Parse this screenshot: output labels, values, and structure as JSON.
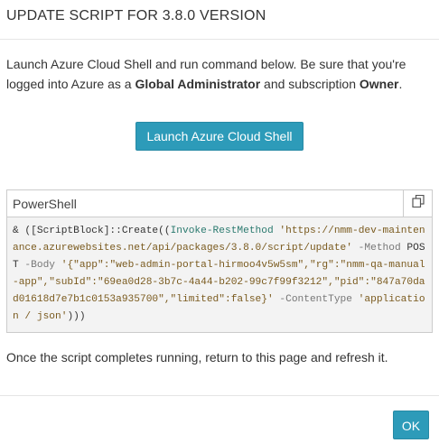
{
  "dialog": {
    "title": "UPDATE SCRIPT FOR 3.8.0 VERSION",
    "intro_text_1": "Launch Azure Cloud Shell and run command below. Be sure that you're logged into Azure as a ",
    "intro_bold_1": "Global Administrator",
    "intro_text_2": " and subscription ",
    "intro_bold_2": "Owner",
    "intro_text_3": ".",
    "launch_button": "Launch Azure Cloud Shell",
    "code": {
      "language": "PowerShell",
      "copy_icon": "copy-icon",
      "segments": [
        {
          "t": "& ([ScriptBlock]::Create((",
          "c": "c-plain"
        },
        {
          "t": "Invoke-RestMethod",
          "c": "c-cmd"
        },
        {
          "t": " 'https://nmm-dev-maintenance.azurewebsites.net/api/packages/3.8.0/script/update'",
          "c": "c-str"
        },
        {
          "t": " -Method",
          "c": "c-par"
        },
        {
          "t": " POST",
          "c": "c-plain"
        },
        {
          "t": " -Body",
          "c": "c-par"
        },
        {
          "t": " '{\"app\":\"web-admin-portal-hirmoo4v5w5sm\",\"rg\":\"nmm-qa-manual-app\",\"subId\":\"69ea0d28-3b7c-4a44-b202-99c7f99f3212\",\"pid\":\"847a70dad01618d7e7b1c0153a935700\",\"limited\":false}'",
          "c": "c-str"
        },
        {
          "t": " -ContentType",
          "c": "c-par"
        },
        {
          "t": " 'application / json'",
          "c": "c-str"
        },
        {
          "t": ")))",
          "c": "c-plain"
        }
      ]
    },
    "footer_text": "Once the script completes running, return to this page and refresh it.",
    "ok_button": "OK",
    "colors": {
      "accent": "#2d9bb9",
      "code_background": "#f3f3f3"
    }
  }
}
